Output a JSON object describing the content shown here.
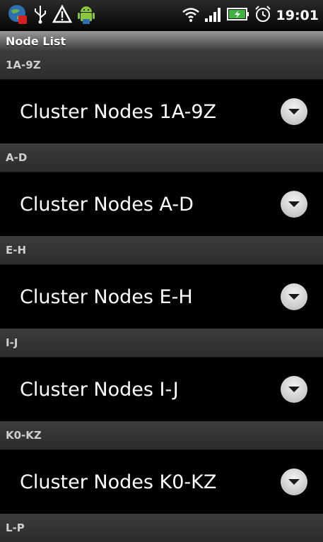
{
  "status_bar": {
    "time": "19:01",
    "icons": [
      "app-globe-icon",
      "usb-icon",
      "warning-icon",
      "android-icon",
      "wifi-icon",
      "signal-icon",
      "battery-charging-icon",
      "alarm-icon"
    ]
  },
  "title_bar": {
    "title": "Node List"
  },
  "sections": [
    {
      "header": "1A-9Z",
      "item_label": "Cluster Nodes 1A-9Z"
    },
    {
      "header": "A-D",
      "item_label": "Cluster Nodes A-D"
    },
    {
      "header": "E-H",
      "item_label": "Cluster Nodes E-H"
    },
    {
      "header": "I-J",
      "item_label": "Cluster Nodes I-J"
    },
    {
      "header": "K0-KZ",
      "item_label": "Cluster Nodes K0-KZ"
    },
    {
      "header": "L-P"
    }
  ],
  "colors": {
    "background": "#000000",
    "section_header": "#333333",
    "section_text": "#cfcfcf",
    "item_text": "#ffffff",
    "expand_button": "#dcdcdc"
  }
}
